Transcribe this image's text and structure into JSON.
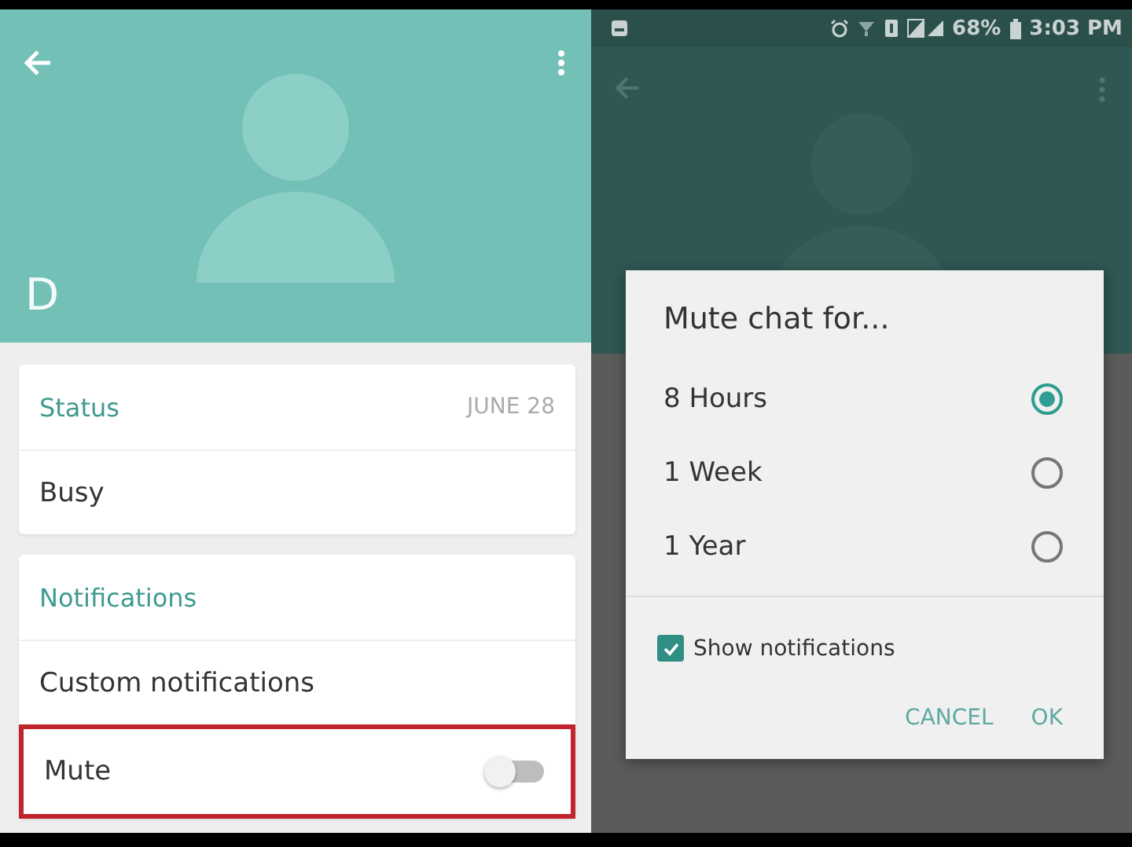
{
  "profile": {
    "name": "D",
    "status_label": "Status",
    "status_date": "JUNE 28",
    "status": "Busy",
    "notifications_label": "Notifications",
    "custom_notifications": "Custom notifications",
    "mute": {
      "label": "Mute",
      "on": false,
      "highlighted": true
    }
  },
  "status_bar": {
    "battery": "68%",
    "time": "3:03 PM"
  },
  "dialog": {
    "title": "Mute chat for...",
    "options": [
      {
        "label": "8 Hours",
        "selected": true
      },
      {
        "label": "1 Week",
        "selected": false
      },
      {
        "label": "1 Year",
        "selected": false
      }
    ],
    "show_notifications": {
      "label": "Show notifications",
      "checked": true
    },
    "buttons": [
      "CANCEL",
      "OK"
    ]
  }
}
